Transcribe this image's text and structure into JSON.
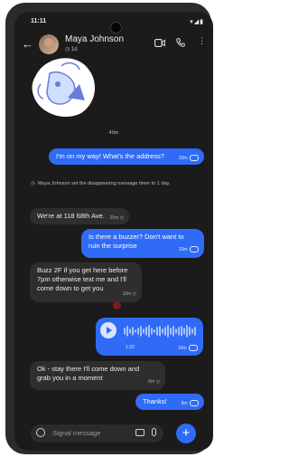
{
  "status_bar": {
    "time": "11:11"
  },
  "header": {
    "back_icon": "arrow-left-icon",
    "contact_name": "Maya Johnson",
    "disappearing_timer": "1d",
    "video_icon": "video-camera-icon",
    "call_icon": "phone-icon",
    "more_icon": "more-vertical-icon"
  },
  "conversation": {
    "divider_time": "40m",
    "system_message": "Maya Johnson set the disappearing message timer to 1 day.",
    "messages": [
      {
        "dir": "out",
        "text": "I'm on my way! What's the address?",
        "time": "30m"
      },
      {
        "dir": "in",
        "text": "We're at 118 68th Ave.",
        "time": "25m"
      },
      {
        "dir": "out",
        "text": "Is there a buzzer? Don't want to ruin the surprise",
        "time": "20m"
      },
      {
        "dir": "in",
        "text": "Buzz 2F if you get here before 7pm otherwise text me and I'll come down to get you",
        "time": "18m"
      },
      {
        "dir": "out",
        "type": "voice",
        "duration": "1:32",
        "time": "10m"
      },
      {
        "dir": "in",
        "text": "Ok - stay there I'll come down and grab you in a moment",
        "time": "8m"
      },
      {
        "dir": "out",
        "text": "Thanks!",
        "time": "8m"
      }
    ]
  },
  "composer": {
    "placeholder": "Signal message"
  },
  "colors": {
    "accent": "#2f6bf6",
    "background": "#1b1b1b",
    "incoming_bubble": "#2e2e2e"
  }
}
